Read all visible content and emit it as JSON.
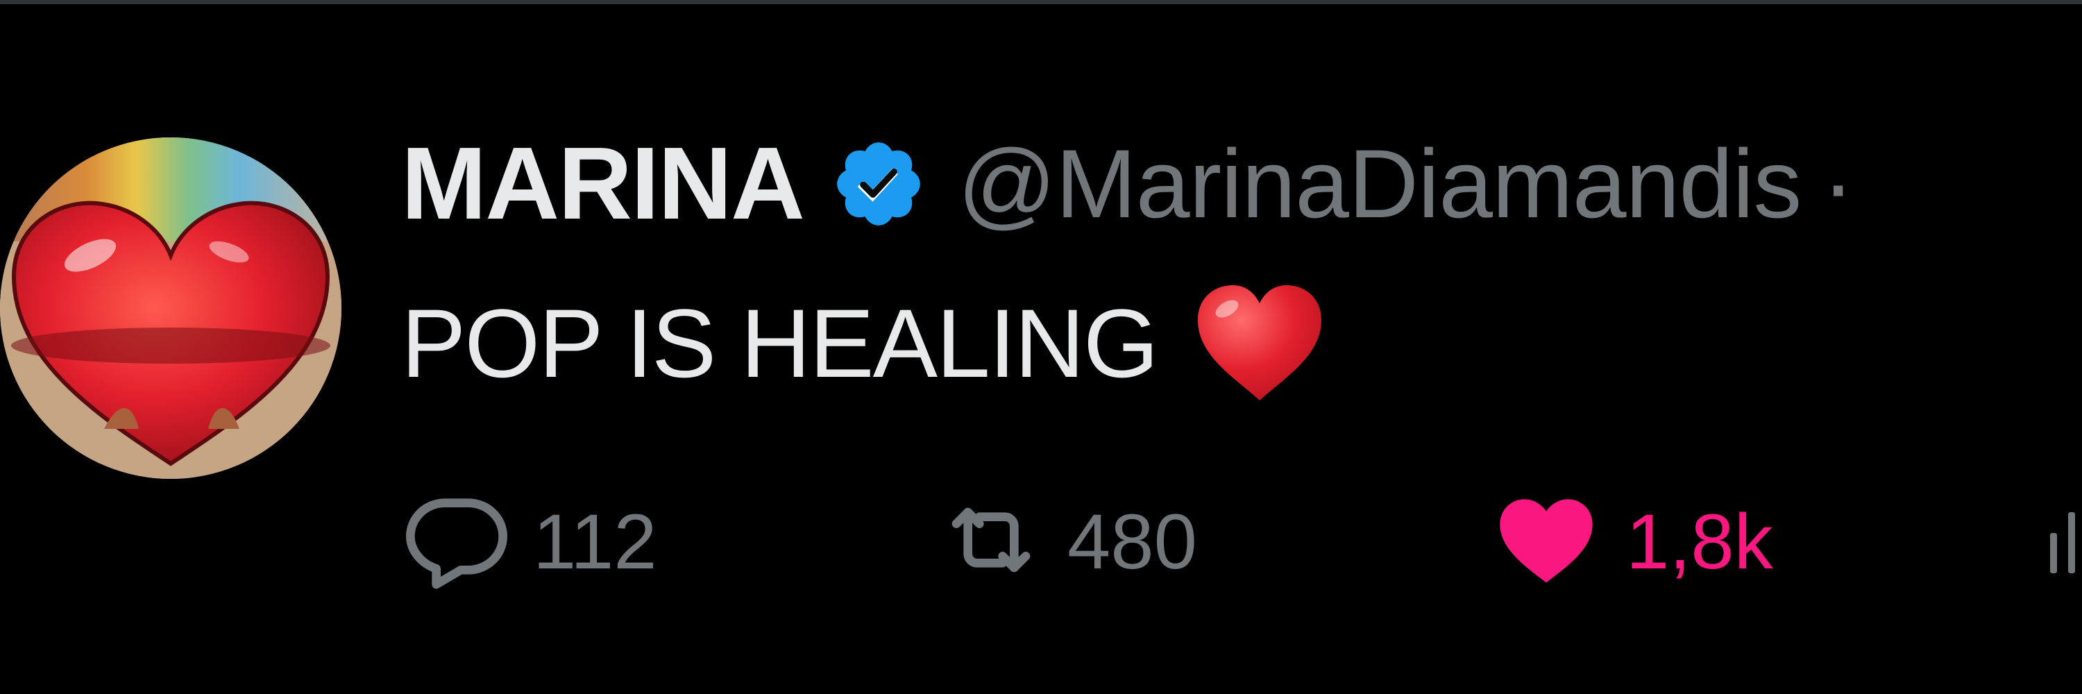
{
  "tweet": {
    "display_name": "MARINA",
    "handle": "@MarinaDiamandis",
    "separator": "·",
    "text": "POP IS HEALING",
    "emoji": "red-heart-emoji"
  },
  "actions": {
    "reply": {
      "icon": "reply-bubble-icon",
      "count": "112"
    },
    "retweet": {
      "icon": "retweet-icon",
      "count": "480"
    },
    "like": {
      "icon": "heart-filled-icon",
      "count": "1,8k",
      "liked": true
    },
    "views": {
      "icon": "views-bar-icon"
    }
  },
  "colors": {
    "background": "#000000",
    "primary_text": "#e7e9ea",
    "secondary_text": "#71767b",
    "verified_blue": "#1d9bf0",
    "like_pink": "#f91880",
    "emoji_red": "#e3202d"
  }
}
